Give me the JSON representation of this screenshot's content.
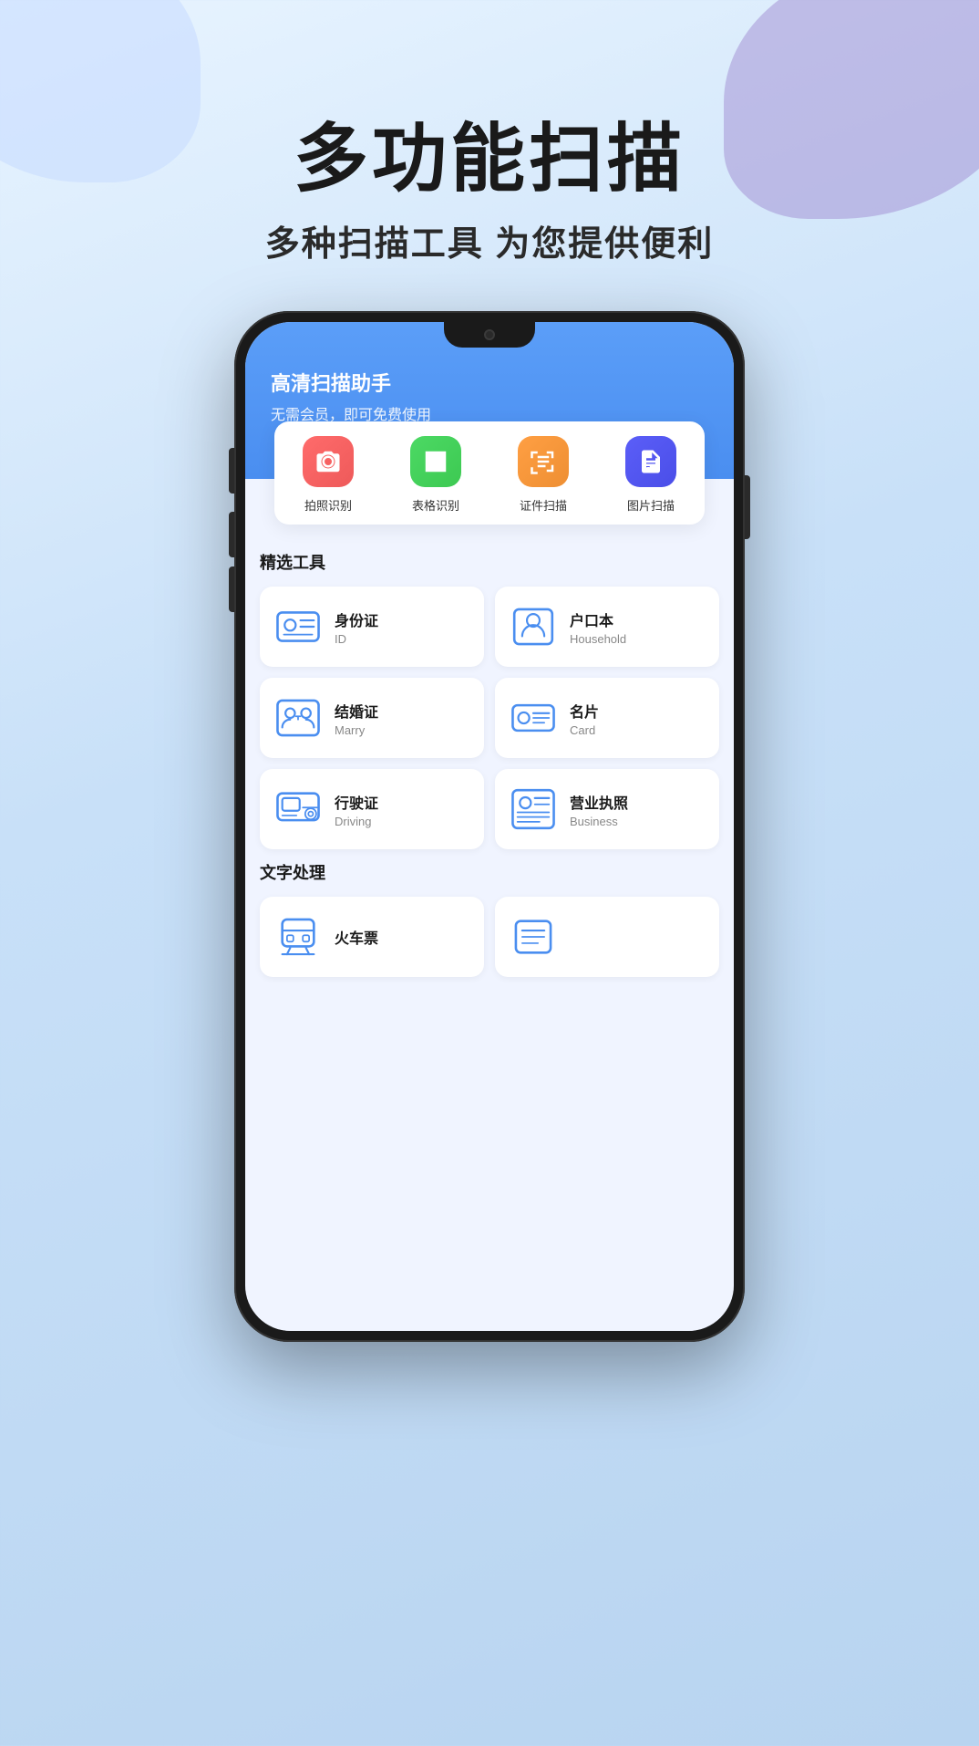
{
  "background": {
    "color_start": "#e8f4ff",
    "color_end": "#b8d4f0"
  },
  "page_header": {
    "main_title": "多功能扫描",
    "sub_title": "多种扫描工具 为您提供便利"
  },
  "phone": {
    "app_header": {
      "title": "高清扫描助手",
      "subtitle": "无需会员，即可免费使用"
    },
    "scan_tools": [
      {
        "label": "拍照识别",
        "icon_color": "red",
        "icon_type": "camera"
      },
      {
        "label": "表格识别",
        "icon_color": "green",
        "icon_type": "table"
      },
      {
        "label": "证件扫描",
        "icon_color": "orange",
        "icon_type": "id-scan"
      },
      {
        "label": "图片扫描",
        "icon_color": "purple",
        "icon_type": "pdf"
      }
    ],
    "section_tools_label": "精选工具",
    "tools": [
      {
        "name": "身份证",
        "sub": "ID",
        "icon_type": "id-card"
      },
      {
        "name": "户口本",
        "sub": "Household",
        "icon_type": "household"
      },
      {
        "name": "结婚证",
        "sub": "Marry",
        "icon_type": "marry"
      },
      {
        "name": "名片",
        "sub": "Card",
        "icon_type": "business-card"
      },
      {
        "name": "行驶证",
        "sub": "Driving",
        "icon_type": "driving"
      },
      {
        "name": "营业执照",
        "sub": "Business",
        "icon_type": "license"
      }
    ],
    "section_text_label": "文字处理",
    "text_tools": [
      {
        "name": "火车票",
        "sub": "",
        "icon_type": "train"
      },
      {
        "name": "",
        "sub": "",
        "icon_type": "other"
      }
    ]
  }
}
